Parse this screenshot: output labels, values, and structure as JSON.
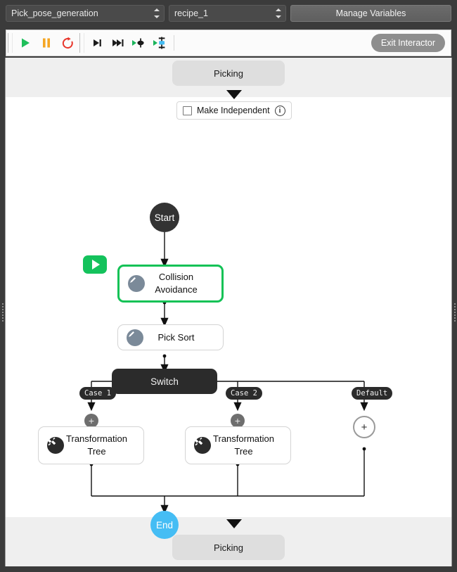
{
  "window": {
    "accent_green": "#13c256",
    "accent_blue": "#45bdf4",
    "chrome_dark": "#3b3b3b"
  },
  "topbar": {
    "program_select": {
      "value": "Pick_pose_generation",
      "icon": "spinner-arrows-icon"
    },
    "recipe_select": {
      "value": "recipe_1",
      "icon": "spinner-arrows-icon"
    },
    "manage_variables_label": "Manage Variables"
  },
  "toolbar": {
    "buttons": [
      {
        "name": "play-button",
        "icon": "play-icon",
        "color": "#1fbf5b"
      },
      {
        "name": "pause-button",
        "icon": "pause-icon",
        "color": "#f5a623"
      },
      {
        "name": "reset-button",
        "icon": "reload-icon",
        "color": "#e8352a"
      },
      {
        "name": "step-over-button",
        "icon": "step-over-icon",
        "color": "#1a1a1a"
      },
      {
        "name": "step-forward-button",
        "icon": "step-forward-icon",
        "color": "#1a1a1a"
      },
      {
        "name": "step-into-button",
        "icon": "step-into-icon",
        "color": "#1a1a1a"
      },
      {
        "name": "step-into-robot-button",
        "icon": "step-into-robot-icon",
        "color": "#45bdf4"
      }
    ],
    "exit_label": "Exit Interactor"
  },
  "panel": {
    "parent_chip_top": "Picking",
    "parent_chip_bottom": "Picking",
    "make_independent": {
      "label": "Make Independent",
      "checked": false,
      "info_glyph": "i",
      "info_icon": "info-icon"
    }
  },
  "graph": {
    "start_label": "Start",
    "end_label": "End",
    "switch_label": "Switch",
    "nodes": [
      {
        "id": "collision",
        "label_line1": "Collision",
        "label_line2": "Avoidance",
        "icon": "pen-icon",
        "selected": true,
        "running": true
      },
      {
        "id": "picksort",
        "label_line1": "Pick Sort",
        "label_line2": "",
        "icon": "pen-icon",
        "selected": false,
        "running": false
      },
      {
        "id": "tt1",
        "label_line1": "Transformation",
        "label_line2": "Tree",
        "icon": "tool-icon",
        "selected": false,
        "running": false
      },
      {
        "id": "tt2",
        "label_line1": "Transformation",
        "label_line2": "Tree",
        "icon": "tool-icon",
        "selected": false,
        "running": false
      }
    ],
    "branches": [
      {
        "label": "Case 1",
        "plus": "+",
        "type": "small"
      },
      {
        "label": "Case 2",
        "plus": "+",
        "type": "small"
      },
      {
        "label": "Default",
        "plus": "+",
        "type": "large"
      }
    ]
  }
}
